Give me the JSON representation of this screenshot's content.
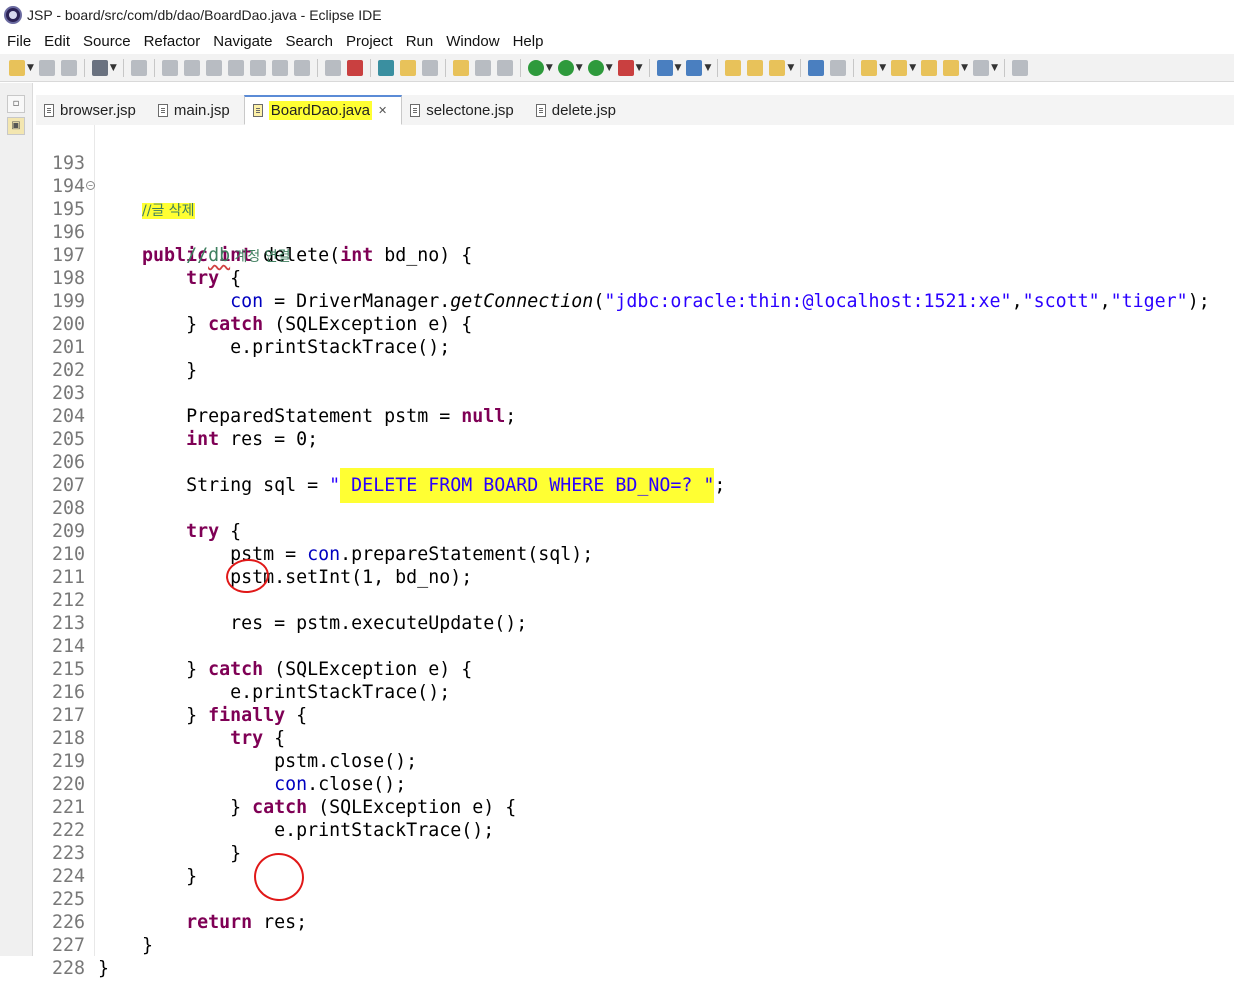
{
  "window": {
    "title": "JSP - board/src/com/db/dao/BoardDao.java - Eclipse IDE"
  },
  "menu": [
    "File",
    "Edit",
    "Source",
    "Refactor",
    "Navigate",
    "Search",
    "Project",
    "Run",
    "Window",
    "Help"
  ],
  "tabs": [
    {
      "label": "browser.jsp",
      "active": false
    },
    {
      "label": "main.jsp",
      "active": false
    },
    {
      "label": "BoardDao.java",
      "active": true
    },
    {
      "label": "selectone.jsp",
      "active": false
    },
    {
      "label": "delete.jsp",
      "active": false
    }
  ],
  "close_symbol": "✕",
  "lines": [
    {
      "n": "193"
    },
    {
      "n": "194"
    },
    {
      "n": "195"
    },
    {
      "n": "196"
    },
    {
      "n": "197"
    },
    {
      "n": "198"
    },
    {
      "n": "199"
    },
    {
      "n": "200"
    },
    {
      "n": "201"
    },
    {
      "n": "202"
    },
    {
      "n": "203"
    },
    {
      "n": "204"
    },
    {
      "n": "205"
    },
    {
      "n": "206"
    },
    {
      "n": "207"
    },
    {
      "n": "208"
    },
    {
      "n": "209"
    },
    {
      "n": "210"
    },
    {
      "n": "211"
    },
    {
      "n": "212"
    },
    {
      "n": "213"
    },
    {
      "n": "214"
    },
    {
      "n": "215"
    },
    {
      "n": "216"
    },
    {
      "n": "217"
    },
    {
      "n": "218"
    },
    {
      "n": "219"
    },
    {
      "n": "220"
    },
    {
      "n": "221"
    },
    {
      "n": "222"
    },
    {
      "n": "223"
    },
    {
      "n": "224"
    },
    {
      "n": "225"
    },
    {
      "n": "226"
    },
    {
      "n": "227"
    },
    {
      "n": "228"
    }
  ],
  "code": {
    "l194_comment": "//글 삭제",
    "l195_public": "public",
    "l195_int": "int",
    "l195_rest": " delete(",
    "l195_int2": "int",
    "l195_end": " bd_no) {",
    "l196_slash": "//",
    "l196_db": "db",
    "l196_kor": " 계정 연결",
    "l197_try": "try",
    "l197_brace": " {",
    "l198_con": "con",
    "l198_mid": " = DriverManager.",
    "l198_method": "getConnection",
    "l198_open": "(",
    "l198_s1": "\"jdbc:oracle:thin:@localhost:1521:xe\"",
    "l198_c1": ",",
    "l198_s2": "\"scott\"",
    "l198_c2": ",",
    "l198_s3": "\"tiger\"",
    "l198_end": ");",
    "l199_close": "} ",
    "l199_catch": "catch",
    "l199_rest": " (SQLException e) {",
    "l200": "e.printStackTrace();",
    "l201": "}",
    "l203_a": "PreparedStatement pstm = ",
    "l203_null": "null",
    "l203_end": ";",
    "l204_int": "int",
    "l204_rest": " res = 0;",
    "l206_a": "String sql = ",
    "l206_q": "\"",
    "l206_sql": " DELETE FROM BOARD WHERE BD_NO=? ",
    "l206_q2": "\"",
    "l206_end": ";",
    "l208_try": "try",
    "l208_brace": " {",
    "l209_a": "pstm = ",
    "l209_con": "con",
    "l209_b": ".prepareStatement(sql);",
    "l210": "pstm.setInt(1, bd_no);",
    "l212_res": "res",
    "l212_b": " = pstm.executeUpdate();",
    "l214_close": "} ",
    "l214_catch": "catch",
    "l214_rest": " (SQLException e) {",
    "l215": "e.printStackTrace();",
    "l216_close": "} ",
    "l216_finally": "finally",
    "l216_brace": " {",
    "l217_try": "try",
    "l217_brace": " {",
    "l218": "pstm.close();",
    "l219_con": "con",
    "l219_b": ".close();",
    "l220_close": "} ",
    "l220_catch": "catch",
    "l220_rest": " (SQLException e) {",
    "l221": "e.printStackTrace();",
    "l222": "}",
    "l223": "}",
    "l225_return": "return",
    "l225_rest": " res;",
    "l226": "}",
    "l227": "}"
  },
  "colors": {
    "keyword": "#7f0055",
    "comment": "#3f7f5f",
    "string": "#2a00ff",
    "field": "#0000c0",
    "highlight": "#ffff33",
    "annotation": "#e01818"
  }
}
